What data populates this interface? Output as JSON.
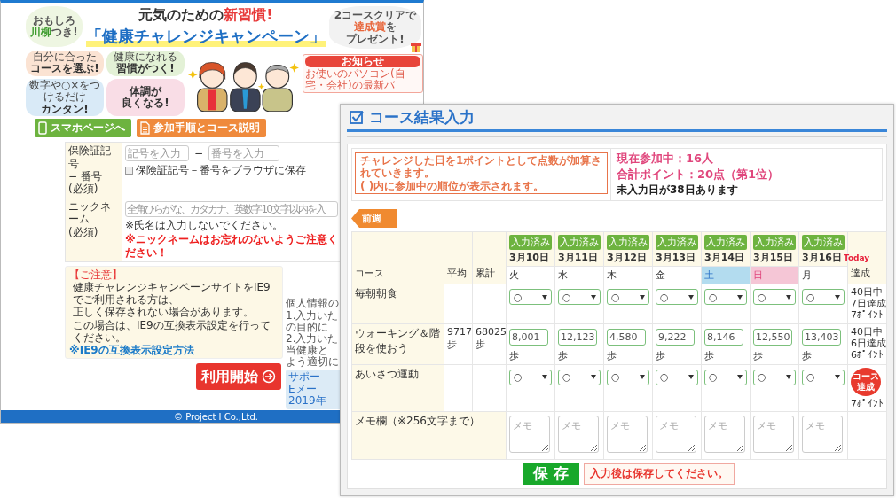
{
  "left_window": {
    "senryu_bubble": {
      "top": "おもしろ",
      "parts": [
        {
          "text": "川柳",
          "accent": true
        },
        {
          "text": "つき!",
          "accent": false
        }
      ]
    },
    "headline": [
      {
        "text": "元気のための",
        "accent": false
      },
      {
        "text": "新習慣!",
        "accent": true
      }
    ],
    "campaign_title": "「健康チャレンジキャンペーン」",
    "prize_bubble": {
      "top": "2コースクリアで",
      "parts": [
        {
          "text": "達成賞",
          "accent": true
        },
        {
          "text": "を",
          "accent": false
        }
      ],
      "bottom": "プレゼント!"
    },
    "features": [
      {
        "caption": "自分に合った",
        "title": [
          "コースを選ぶ!"
        ],
        "color": "#fbe3d3"
      },
      {
        "caption": "健康になれる",
        "title": [
          "習慣がつく!"
        ],
        "color": "#e3f1d6"
      },
      {
        "caption": "数字や○×をつけるだけ",
        "title": [
          "カンタン!"
        ],
        "color": "#d9eaf7"
      },
      {
        "title": [
          "体調が",
          "良くなる!"
        ],
        "color": "#f9dde6"
      }
    ],
    "news": {
      "title": "お知らせ",
      "body": "お使いのパソコン(自宅・会社)の最新バ"
    },
    "buttons": [
      {
        "label": "スマホページへ",
        "kind": "phone"
      },
      {
        "label": "参加手順とコース説明",
        "kind": "document"
      }
    ],
    "form": {
      "insurance": {
        "label": [
          "保険証記号",
          "− 番号"
        ],
        "required": "(必須)",
        "placeholders": [
          "記号を入力",
          "番号を入力"
        ],
        "separator": "−",
        "save_checkbox": {
          "label": "保険証記号－番号をブラウザに保存",
          "checked": false
        }
      },
      "nickname": {
        "label": "ニックネーム",
        "required": "(必須)",
        "placeholder": "全角ひらがな、カタカナ、英数字10文字以内を入",
        "notes": [
          {
            "text": "※氏名は入力しないでください。",
            "kind": "plain"
          },
          {
            "text": "※ニックネームはお忘れのないようご注意ください！",
            "kind": "warning"
          }
        ]
      }
    },
    "notice": {
      "title": "【ご注意】",
      "lines": [
        "健康チャレンジキャンペーンサイトをIE9でご利用される方は、",
        "正しく保存されない場合があります。",
        "この場合は、IE9の互換表示設定を行ってください。"
      ],
      "link": "※IE9の互換表示設定方法"
    },
    "start_button": "利用開始",
    "privacy_lines": [
      "個人情報の",
      "1.入力いた",
      "の目的に",
      "2.入力いた",
      "当健康と",
      "よう適切に"
    ],
    "support_lines": [
      "サポー",
      "Eメー",
      "2019年"
    ],
    "footer": "© Project I Co.,Ltd."
  },
  "right_window": {
    "title": "コース結果入力",
    "rules": [
      "チャレンジした日を1ポイントとして点数が加算されていきます。",
      "( )内に参加中の順位が表示されます。"
    ],
    "stats": [
      {
        "text": "現在参加中：16人",
        "kind": "highlight"
      },
      {
        "text": "合計ポイント：20点（第1位）",
        "kind": "highlight"
      },
      {
        "text": "未入力日が38日あります",
        "kind": "plain"
      }
    ],
    "prev_week_button": "前週",
    "table": {
      "columns": [
        "コース",
        "平均",
        "累計"
      ],
      "achievement_column": "達成",
      "days": [
        {
          "status": "入力済み",
          "date": "3月10日",
          "weekday": "火",
          "kind": "weekday"
        },
        {
          "status": "入力済み",
          "date": "3月11日",
          "weekday": "水",
          "kind": "weekday"
        },
        {
          "status": "入力済み",
          "date": "3月12日",
          "weekday": "木",
          "kind": "weekday"
        },
        {
          "status": "入力済み",
          "date": "3月13日",
          "weekday": "金",
          "kind": "weekday"
        },
        {
          "status": "入力済み",
          "date": "3月14日",
          "weekday": "土",
          "kind": "saturday"
        },
        {
          "status": "入力済み",
          "date": "3月15日",
          "weekday": "日",
          "kind": "sunday"
        },
        {
          "status": "入力済み",
          "date": "3月16日",
          "weekday": "月",
          "kind": "weekday",
          "today_label": "Today"
        }
      ],
      "rows": [
        {
          "course": "毎朝朝食",
          "kind": "select",
          "values": [
            {
              "value": "○"
            },
            {
              "value": "○"
            },
            {
              "value": "○"
            },
            {
              "value": "○"
            },
            {
              "value": "○"
            },
            {
              "value": "○"
            },
            {
              "value": "○"
            }
          ],
          "achievement": [
            "40日中",
            "7日達成",
            "7ﾎﾟｲﾝﾄ"
          ]
        },
        {
          "course": "ウォーキング＆階段を使おう",
          "kind": "number",
          "average": "9717",
          "average_unit": "歩",
          "total": "68025",
          "total_unit": "歩",
          "values": [
            {
              "value": "8,001",
              "unit": "歩"
            },
            {
              "value": "12,123",
              "unit": "歩"
            },
            {
              "value": "4,580",
              "unit": "歩"
            },
            {
              "value": "9,222",
              "unit": "歩"
            },
            {
              "value": "8,146",
              "unit": "歩"
            },
            {
              "value": "12,550",
              "unit": "歩"
            },
            {
              "value": "13,403",
              "unit": "歩"
            }
          ],
          "achievement": [
            "40日中",
            "6日達成",
            "6ﾎﾟｲﾝﾄ"
          ]
        },
        {
          "course": "あいさつ運動",
          "kind": "select",
          "values": [
            {
              "value": "○"
            },
            {
              "value": "○"
            },
            {
              "value": "○"
            },
            {
              "value": "○"
            },
            {
              "value": "○"
            },
            {
              "value": "○"
            },
            {
              "value": "○"
            }
          ],
          "badge": "コース達成",
          "achievement": [
            "7ﾎﾟｲﾝﾄ"
          ]
        }
      ],
      "memo": {
        "label": "メモ欄（※256文字まで）",
        "placeholders": [
          "メモ",
          "メモ",
          "メモ",
          "メモ",
          "メモ",
          "メモ",
          "メモ"
        ]
      }
    },
    "save_button": "保 存",
    "save_note": "入力後は保存してください。"
  }
}
